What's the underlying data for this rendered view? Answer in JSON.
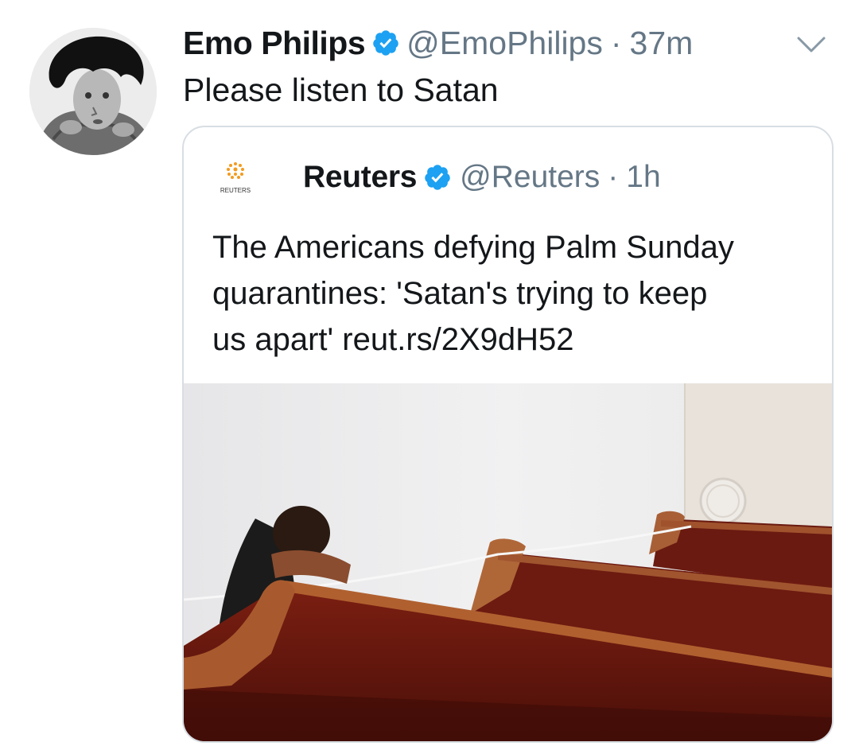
{
  "tweet": {
    "author_name": "Emo Philips",
    "handle": "@EmoPhilips",
    "separator": "·",
    "time": "37m",
    "text": "Please listen to Satan"
  },
  "quoted_tweet": {
    "author_name": "Reuters",
    "handle": "@Reuters",
    "separator": "·",
    "time": "1h",
    "logo_text": "REUTERS",
    "text_lines": [
      "The Americans defying Palm Sunday",
      "quarantines: 'Satan's trying to keep",
      "us apart' reut.rs/2X9dH52"
    ]
  },
  "icons": {
    "verified": "verified-badge-icon",
    "caret": "chevron-down-icon",
    "brand_logo": "reuters-logo-icon"
  },
  "colors": {
    "verified_blue": "#1da1f2",
    "muted_text": "#657786",
    "reuters_orange": "#f29b1f"
  }
}
